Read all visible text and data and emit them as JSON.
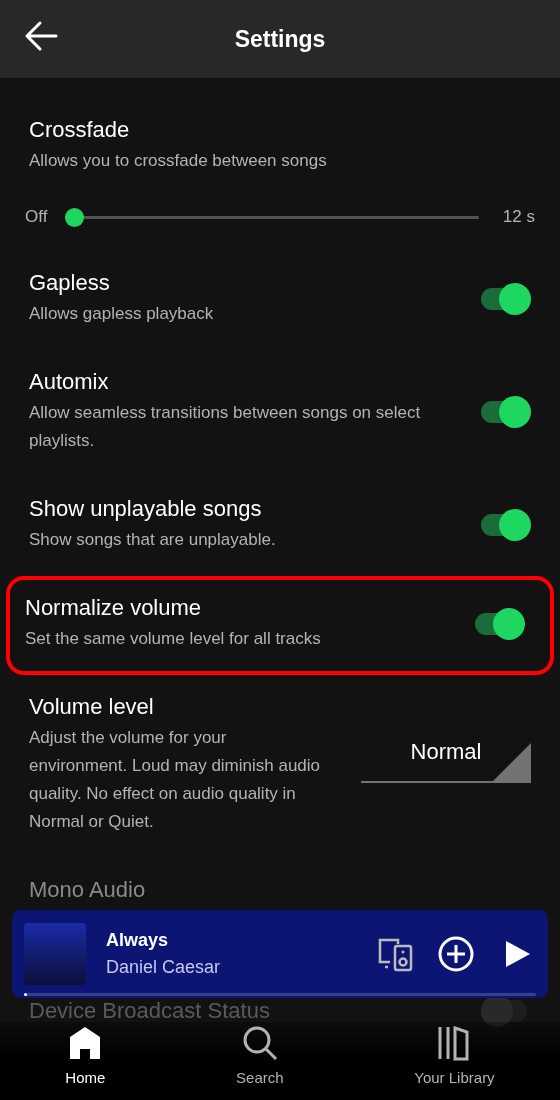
{
  "header": {
    "title": "Settings"
  },
  "settings": [
    {
      "kind": "slider",
      "title": "Crossfade",
      "description": "Allows you to crossfade between songs",
      "min_label": "Off",
      "max_label": "12 s",
      "level": 0
    },
    {
      "kind": "toggle",
      "title": "Gapless",
      "description": "Allows gapless playback",
      "on": true,
      "highlighted": false
    },
    {
      "kind": "toggle",
      "title": "Automix",
      "description": "Allow seamless transitions between songs on select playlists.",
      "on": true,
      "highlighted": false
    },
    {
      "kind": "toggle",
      "title": "Show unplayable songs",
      "description": "Show songs that are unplayable.",
      "on": true,
      "highlighted": false
    },
    {
      "kind": "toggle",
      "title": "Normalize volume",
      "description": "Set the same volume level for all tracks",
      "on": true,
      "highlighted": true
    },
    {
      "kind": "dropdown",
      "title": "Volume level",
      "description": "Adjust the volume for your environment. Loud may diminish audio quality. No effect on audio quality in Normal or Quiet.",
      "value": "Normal"
    },
    {
      "kind": "faded",
      "title": "Mono Audio"
    },
    {
      "kind": "faded-toggle",
      "title": "Device Broadcast Status",
      "on": false
    }
  ],
  "player": {
    "title": "Always",
    "artist": "Daniel Caesar",
    "level": 0.005
  },
  "nav": [
    {
      "kind": "home",
      "label": "Home",
      "selected": true
    },
    {
      "kind": "search",
      "label": "Search",
      "selected": false
    },
    {
      "kind": "library",
      "label": "Your Library",
      "selected": false
    }
  ]
}
